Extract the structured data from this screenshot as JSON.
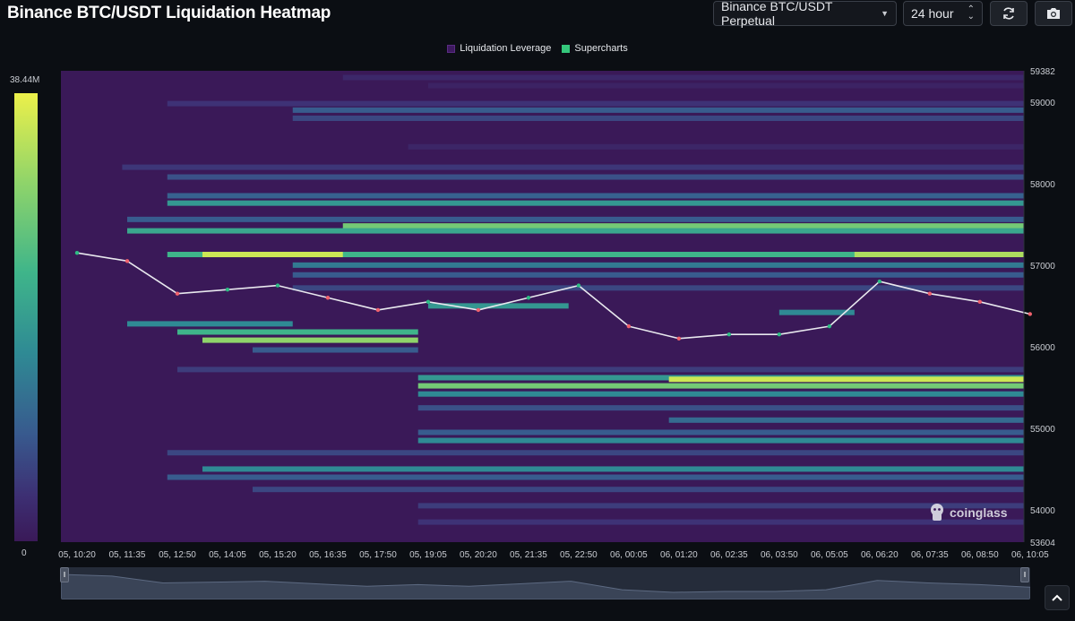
{
  "header": {
    "title": "Binance BTC/USDT Liquidation Heatmap",
    "pair_select": "Binance BTC/USDT Perpetual",
    "range_select": "24 hour"
  },
  "legend": [
    {
      "label": "Liquidation Leverage",
      "color": "#3d1a5e"
    },
    {
      "label": "Supercharts",
      "color": "#34c77b"
    }
  ],
  "colorbar": {
    "max_label": "38.44M",
    "min_label": "0"
  },
  "watermark": "coinglass",
  "chart_data": {
    "type": "heatmap",
    "title": "Binance BTC/USDT Liquidation Heatmap",
    "ylim": [
      53604,
      59382
    ],
    "y_ticks": [
      "59382",
      "59000",
      "58000",
      "57000",
      "56000",
      "55000",
      "54000",
      "53604"
    ],
    "x_ticks": [
      "05, 10:20",
      "05, 11:35",
      "05, 12:50",
      "05, 14:05",
      "05, 15:20",
      "05, 16:35",
      "05, 17:50",
      "05, 19:05",
      "05, 20:20",
      "05, 21:35",
      "05, 22:50",
      "06, 00:05",
      "06, 01:20",
      "06, 02:35",
      "06, 03:50",
      "06, 05:05",
      "06, 06:20",
      "06, 07:35",
      "06, 08:50",
      "06, 10:05"
    ],
    "colorscale": {
      "min": 0,
      "max": 38.44,
      "unit": "M"
    },
    "price_series": {
      "name": "Supercharts",
      "x_index": [
        0,
        1,
        2,
        3,
        4,
        5,
        6,
        7,
        8,
        9,
        10,
        11,
        12,
        13,
        14,
        15,
        16,
        17,
        18,
        19
      ],
      "values": [
        57150,
        57050,
        56650,
        56700,
        56750,
        56600,
        56450,
        56550,
        56450,
        56600,
        56750,
        56250,
        56100,
        56150,
        56150,
        56250,
        56800,
        56650,
        56550,
        56400
      ]
    },
    "liquidation_bands": [
      {
        "price": 59300,
        "from": 5.3,
        "to": 20,
        "intensity": 0.12
      },
      {
        "price": 59200,
        "from": 7.0,
        "to": 20,
        "intensity": 0.08
      },
      {
        "price": 58980,
        "from": 1.8,
        "to": 20,
        "intensity": 0.2
      },
      {
        "price": 58900,
        "from": 4.3,
        "to": 20,
        "intensity": 0.4
      },
      {
        "price": 58800,
        "from": 4.3,
        "to": 20,
        "intensity": 0.3
      },
      {
        "price": 58450,
        "from": 6.6,
        "to": 20,
        "intensity": 0.1
      },
      {
        "price": 58200,
        "from": 0.9,
        "to": 20,
        "intensity": 0.22
      },
      {
        "price": 58080,
        "from": 1.8,
        "to": 20,
        "intensity": 0.35
      },
      {
        "price": 57850,
        "from": 1.8,
        "to": 20,
        "intensity": 0.42
      },
      {
        "price": 57760,
        "from": 1.8,
        "to": 20,
        "intensity": 0.6
      },
      {
        "price": 57560,
        "from": 1.0,
        "to": 20,
        "intensity": 0.4
      },
      {
        "price": 57480,
        "from": 5.3,
        "to": 20,
        "intensity": 0.8
      },
      {
        "price": 57420,
        "from": 1.0,
        "to": 20,
        "intensity": 0.65
      },
      {
        "price": 57130,
        "from": 1.8,
        "to": 20,
        "intensity": 0.7
      },
      {
        "price": 57130,
        "from": 2.5,
        "to": 5.3,
        "intensity": 0.95
      },
      {
        "price": 57130,
        "from": 15.5,
        "to": 20,
        "intensity": 0.9
      },
      {
        "price": 57000,
        "from": 4.3,
        "to": 20,
        "intensity": 0.5
      },
      {
        "price": 56880,
        "from": 4.3,
        "to": 20,
        "intensity": 0.4
      },
      {
        "price": 56720,
        "from": 4.3,
        "to": 20,
        "intensity": 0.3
      },
      {
        "price": 56500,
        "from": 7.0,
        "to": 9.8,
        "intensity": 0.6
      },
      {
        "price": 56420,
        "from": 14.0,
        "to": 15.5,
        "intensity": 0.55
      },
      {
        "price": 56280,
        "from": 1.0,
        "to": 4.3,
        "intensity": 0.55
      },
      {
        "price": 56180,
        "from": 2.0,
        "to": 6.8,
        "intensity": 0.7
      },
      {
        "price": 56080,
        "from": 2.5,
        "to": 6.8,
        "intensity": 0.85
      },
      {
        "price": 55960,
        "from": 3.5,
        "to": 6.8,
        "intensity": 0.4
      },
      {
        "price": 55720,
        "from": 2.0,
        "to": 20,
        "intensity": 0.25
      },
      {
        "price": 55620,
        "from": 6.8,
        "to": 20,
        "intensity": 0.6
      },
      {
        "price": 55600,
        "from": 11.8,
        "to": 20,
        "intensity": 0.95
      },
      {
        "price": 55520,
        "from": 6.8,
        "to": 20,
        "intensity": 0.8
      },
      {
        "price": 55420,
        "from": 6.8,
        "to": 20,
        "intensity": 0.55
      },
      {
        "price": 55250,
        "from": 6.8,
        "to": 20,
        "intensity": 0.35
      },
      {
        "price": 55100,
        "from": 11.8,
        "to": 20,
        "intensity": 0.45
      },
      {
        "price": 54950,
        "from": 6.8,
        "to": 20,
        "intensity": 0.4
      },
      {
        "price": 54850,
        "from": 6.8,
        "to": 20,
        "intensity": 0.55
      },
      {
        "price": 54700,
        "from": 1.8,
        "to": 20,
        "intensity": 0.3
      },
      {
        "price": 54500,
        "from": 2.5,
        "to": 20,
        "intensity": 0.55
      },
      {
        "price": 54400,
        "from": 1.8,
        "to": 20,
        "intensity": 0.4
      },
      {
        "price": 54250,
        "from": 3.5,
        "to": 20,
        "intensity": 0.3
      },
      {
        "price": 54050,
        "from": 6.8,
        "to": 20,
        "intensity": 0.25
      },
      {
        "price": 53850,
        "from": 6.8,
        "to": 20,
        "intensity": 0.2
      }
    ]
  }
}
